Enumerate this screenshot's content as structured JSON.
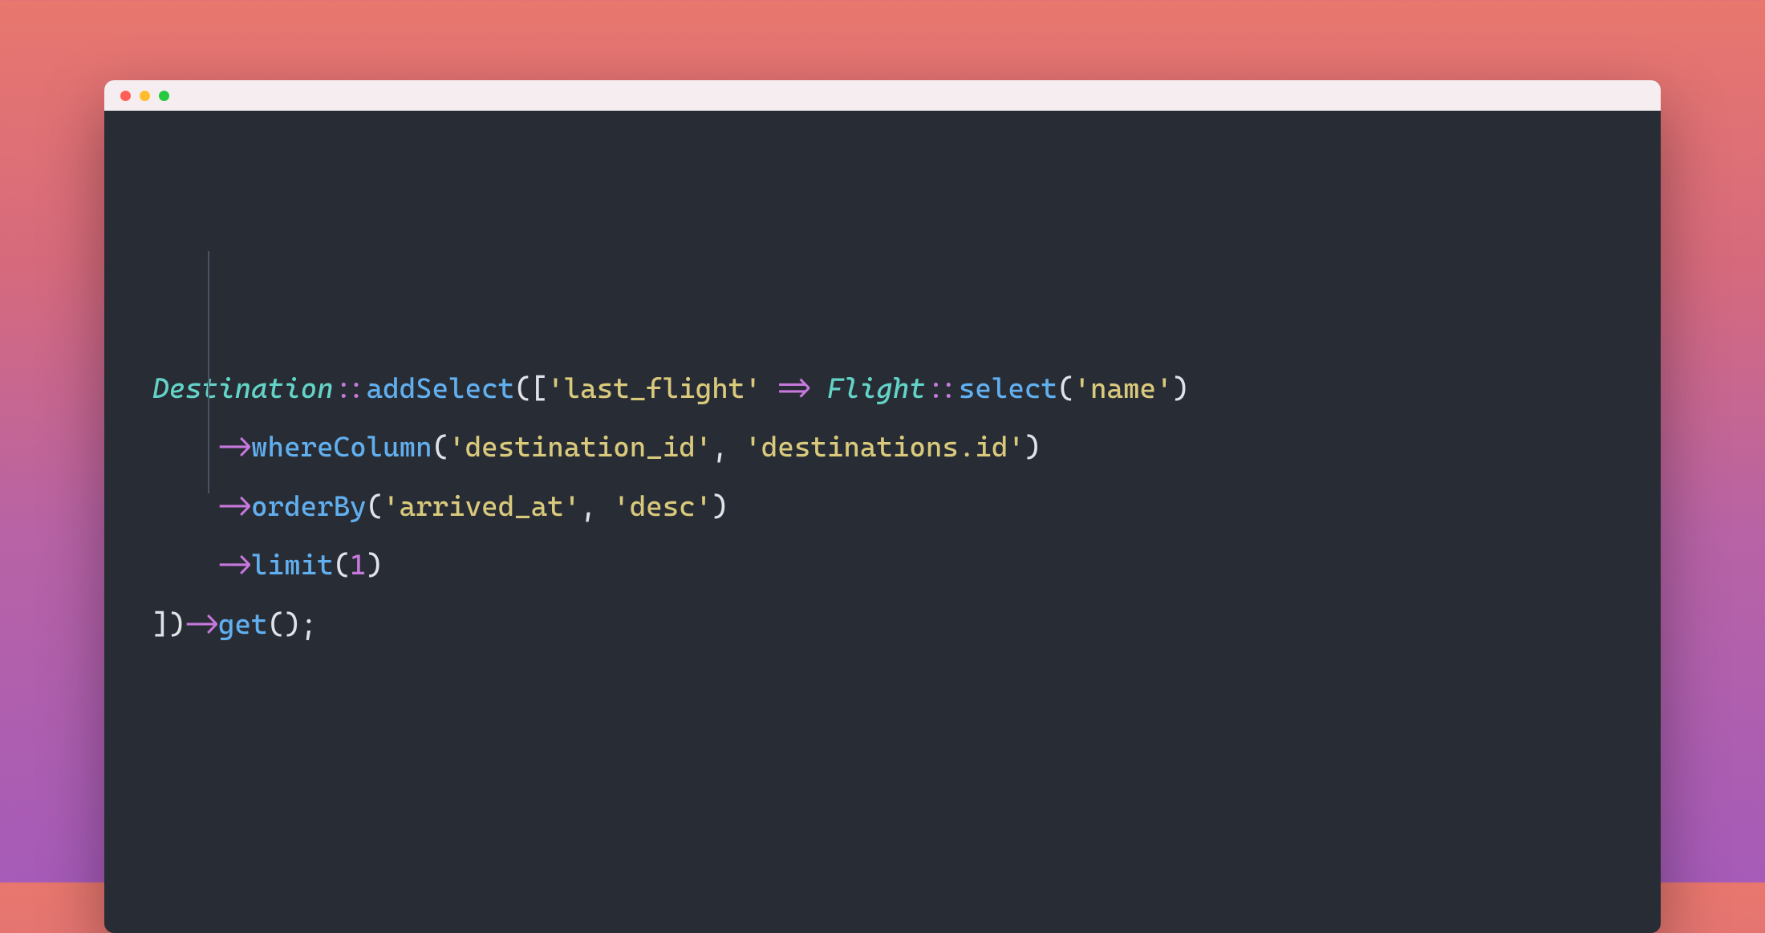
{
  "window": {
    "titlebar": {
      "traffic_lights": [
        "red",
        "yellow",
        "green"
      ]
    }
  },
  "code": {
    "lines": [
      {
        "indent": "",
        "tokens": [
          {
            "t": "Destination",
            "c": "tok-class"
          },
          {
            "t": "::",
            "c": "tok-op"
          },
          {
            "t": "addSelect",
            "c": "tok-method"
          },
          {
            "t": "([",
            "c": "tok-punct"
          },
          {
            "t": "'last_flight'",
            "c": "tok-string"
          },
          {
            "t": " ",
            "c": ""
          },
          {
            "t": "=>",
            "c": "tok-arrow-fat"
          },
          {
            "t": " ",
            "c": ""
          },
          {
            "t": "Flight",
            "c": "tok-class"
          },
          {
            "t": "::",
            "c": "tok-op"
          },
          {
            "t": "select",
            "c": "tok-method"
          },
          {
            "t": "(",
            "c": "tok-punct"
          },
          {
            "t": "'name'",
            "c": "tok-string"
          },
          {
            "t": ")",
            "c": "tok-punct"
          }
        ]
      },
      {
        "indent": "    ",
        "tokens": [
          {
            "t": "->",
            "c": "tok-op"
          },
          {
            "t": "whereColumn",
            "c": "tok-method"
          },
          {
            "t": "(",
            "c": "tok-punct"
          },
          {
            "t": "'destination_id'",
            "c": "tok-string"
          },
          {
            "t": ", ",
            "c": "tok-punct"
          },
          {
            "t": "'destinations.id'",
            "c": "tok-string"
          },
          {
            "t": ")",
            "c": "tok-punct"
          }
        ]
      },
      {
        "indent": "    ",
        "tokens": [
          {
            "t": "->",
            "c": "tok-op"
          },
          {
            "t": "orderBy",
            "c": "tok-method"
          },
          {
            "t": "(",
            "c": "tok-punct"
          },
          {
            "t": "'arrived_at'",
            "c": "tok-string"
          },
          {
            "t": ", ",
            "c": "tok-punct"
          },
          {
            "t": "'desc'",
            "c": "tok-string"
          },
          {
            "t": ")",
            "c": "tok-punct"
          }
        ]
      },
      {
        "indent": "    ",
        "tokens": [
          {
            "t": "->",
            "c": "tok-op"
          },
          {
            "t": "limit",
            "c": "tok-method"
          },
          {
            "t": "(",
            "c": "tok-punct"
          },
          {
            "t": "1",
            "c": "tok-number"
          },
          {
            "t": ")",
            "c": "tok-punct"
          }
        ]
      },
      {
        "indent": "",
        "tokens": [
          {
            "t": "])",
            "c": "tok-punct"
          },
          {
            "t": "->",
            "c": "tok-op"
          },
          {
            "t": "get",
            "c": "tok-method"
          },
          {
            "t": "();",
            "c": "tok-punct"
          }
        ]
      }
    ]
  }
}
